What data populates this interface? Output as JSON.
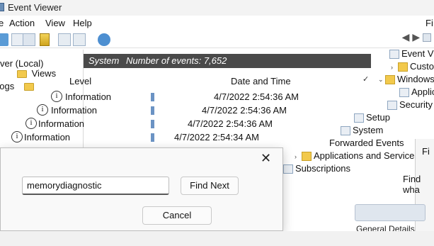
{
  "window": {
    "title": "Event Viewer"
  },
  "menu": [
    {
      "label": "Action"
    },
    {
      "label": "View"
    },
    {
      "label": "Help"
    }
  ],
  "right_menu_peek": "Fi",
  "left_tree": {
    "items": [
      {
        "label": "ver (Local)"
      },
      {
        "label": "Views"
      },
      {
        "label": "Logs"
      }
    ]
  },
  "center": {
    "pane_title": "System",
    "event_count": "Number of events: 7,652",
    "col_level": "Level",
    "col_datetime": "Date and Time",
    "rows": [
      {
        "level": "Information",
        "datetime": "4/7/2022 2:54:36 AM"
      },
      {
        "level": "Information",
        "datetime": "4/7/2022 2:54:36 AM"
      },
      {
        "level": "Information",
        "datetime": "4/7/2022 2:54:36 AM"
      },
      {
        "level": "Information",
        "datetime": "4/7/2022 2:54:34 AM"
      }
    ]
  },
  "overlay_tree": {
    "items": [
      {
        "label": "Event Vi",
        "indent": 0
      },
      {
        "label": "Custom",
        "indent": 1
      },
      {
        "label": "Windows Lo",
        "indent": 0
      },
      {
        "label": "Application",
        "indent": 1
      },
      {
        "label": "Security",
        "indent": 1
      },
      {
        "label": "Setup",
        "indent": 1
      },
      {
        "label": "System",
        "indent": 1
      },
      {
        "label": "Forwarded Events",
        "indent": 1
      },
      {
        "label": "Applications and Services L",
        "indent": 0
      },
      {
        "label": "Subscriptions",
        "indent": 0
      }
    ]
  },
  "find_dialog": {
    "search_value": "memorydiagnostic",
    "find_next_label": "Find Next",
    "cancel_label": "Cancel"
  },
  "find_dialog_2": {
    "title": "Fi",
    "label": "Find wha",
    "tabs": "General   Details"
  }
}
